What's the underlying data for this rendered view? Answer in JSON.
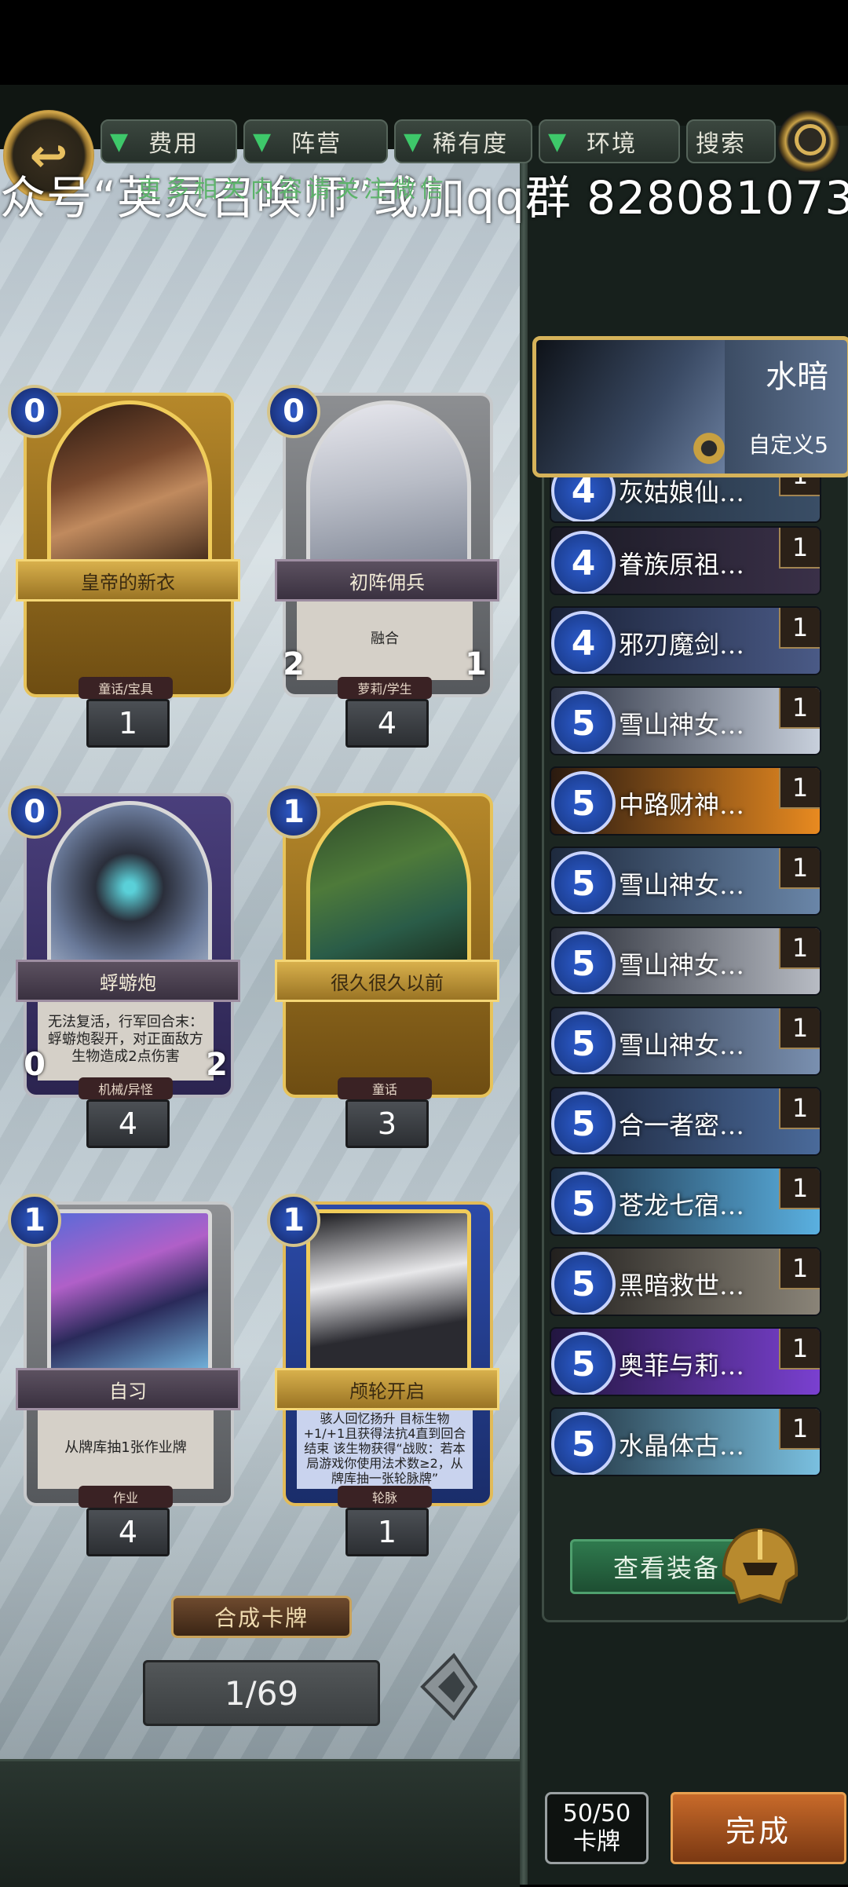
{
  "filters": {
    "cost": "费用",
    "faction": "阵营",
    "rarity": "稀有度",
    "environment": "环境",
    "search": "搜索"
  },
  "watermark": {
    "main": "众号“英灵召唤师”或加qq群 828081073”",
    "overlay": "更多相关内容请关注微信"
  },
  "cards": [
    {
      "name": "皇帝的新衣",
      "cost": "0",
      "tag": "童话/宝具",
      "count": "1",
      "desc": "",
      "atk": "",
      "hp": ""
    },
    {
      "name": "初阵佣兵",
      "cost": "0",
      "tag": "萝莉/学生",
      "count": "4",
      "desc": "融合",
      "atk": "2",
      "hp": "1"
    },
    {
      "name": "蜉蝣炮",
      "cost": "0",
      "tag": "机械/异怪",
      "count": "4",
      "desc": "无法复活，行军回合末：蜉蝣炮裂开，对正面敌方生物造成2点伤害",
      "atk": "0",
      "hp": "2"
    },
    {
      "name": "很久很久以前",
      "cost": "1",
      "tag": "童话",
      "count": "3",
      "desc": "",
      "atk": "",
      "hp": ""
    },
    {
      "name": "自习",
      "cost": "1",
      "tag": "作业",
      "count": "4",
      "desc": "从牌库抽1张作业牌",
      "atk": "",
      "hp": ""
    },
    {
      "name": "颅轮开启",
      "cost": "1",
      "tag": "轮脉",
      "count": "1",
      "desc": "骇人回忆扬升 目标生物+1/+1且获得法抗4直到回合结束 该生物获得“战败：若本局游戏你使用法术数≥2，从牌库抽一张轮脉牌”",
      "atk": "",
      "hp": ""
    }
  ],
  "synth_label": "合成卡牌",
  "pager": "1/69",
  "deck": {
    "title": "水暗",
    "subtitle": "自定义5",
    "items": [
      {
        "cost": "4",
        "name": "灰姑娘仙…",
        "qty": "1"
      },
      {
        "cost": "4",
        "name": "眷族原祖…",
        "qty": "1"
      },
      {
        "cost": "4",
        "name": "邪刃魔剑…",
        "qty": "1"
      },
      {
        "cost": "5",
        "name": "雪山神女…",
        "qty": "1"
      },
      {
        "cost": "5",
        "name": "中路财神…",
        "qty": "1"
      },
      {
        "cost": "5",
        "name": "雪山神女…",
        "qty": "1"
      },
      {
        "cost": "5",
        "name": "雪山神女…",
        "qty": "1"
      },
      {
        "cost": "5",
        "name": "雪山神女…",
        "qty": "1"
      },
      {
        "cost": "5",
        "name": "合一者密…",
        "qty": "1"
      },
      {
        "cost": "5",
        "name": "苍龙七宿…",
        "qty": "1"
      },
      {
        "cost": "5",
        "name": "黑暗救世…",
        "qty": "1"
      },
      {
        "cost": "5",
        "name": "奥菲与莉…",
        "qty": "1"
      },
      {
        "cost": "5",
        "name": "水晶体古…",
        "qty": "1"
      }
    ]
  },
  "equip_label": "查看装备",
  "card_count": {
    "value": "50/50",
    "label": "卡牌"
  },
  "done_label": "完成"
}
